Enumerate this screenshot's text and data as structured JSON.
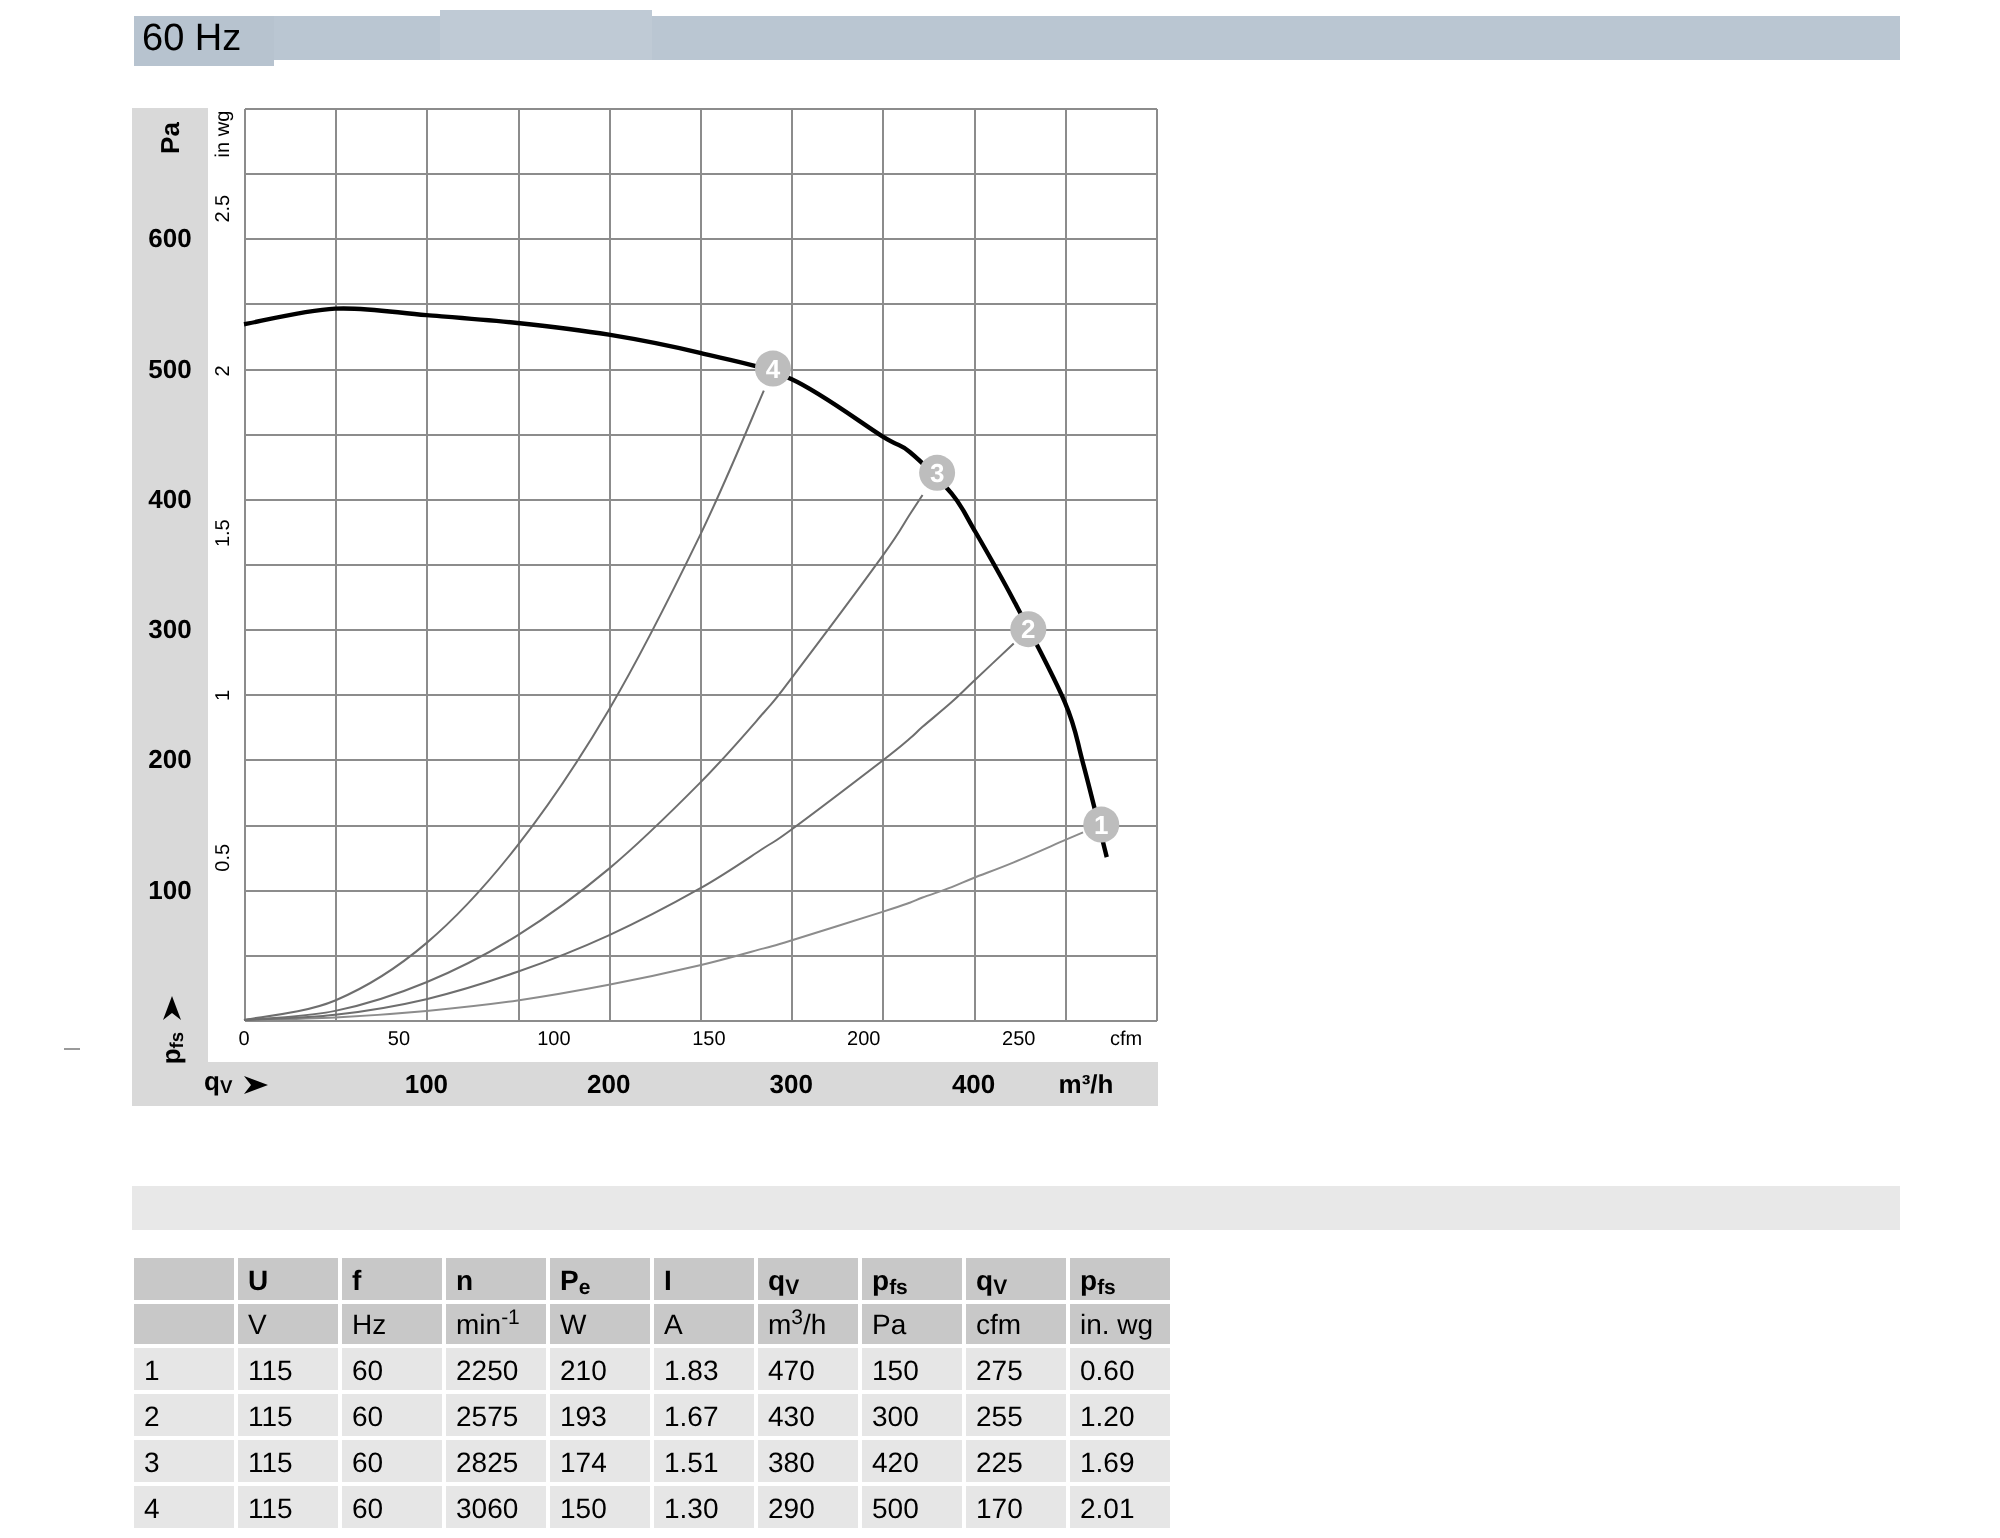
{
  "header": {
    "title": "60 Hz"
  },
  "chart": {
    "y_symbol": {
      "text": "p",
      "sub": "fs"
    },
    "x_symbol": {
      "text": "q",
      "sub": "V"
    },
    "secondary_y_axis": {
      "label": "in wg",
      "ticks": [
        "0.5",
        "1",
        "1.5",
        "2",
        "2.5"
      ]
    },
    "secondary_x_axis": {
      "label": "cfm",
      "ticks": [
        "0",
        "50",
        "100",
        "150",
        "200",
        "250"
      ]
    },
    "chart_data": {
      "type": "line",
      "xlabel": "m³/h",
      "ylabel": "Pa",
      "xlim": [
        0,
        500
      ],
      "ylim": [
        0,
        700
      ],
      "xticks": [
        100,
        200,
        300,
        400
      ],
      "yticks": [
        100,
        200,
        300,
        400,
        500,
        600
      ],
      "grid": true,
      "x": [
        0,
        50,
        100,
        150,
        200,
        250,
        285,
        300,
        350,
        365,
        372,
        388,
        400,
        422,
        450,
        460,
        473
      ],
      "series": [
        {
          "color": "#000000",
          "values": [
            534,
            546,
            541,
            535,
            526,
            512,
            null,
            492,
            448,
            436,
            null,
            404,
            377,
            322,
            244,
            197,
            125
          ]
        },
        {
          "color": "#8c8c8c",
          "values": [
            0,
            2,
            7,
            15,
            27,
            42,
            55,
            61,
            83,
            90,
            94,
            102,
            109,
            121,
            138,
            144,
            null
          ]
        },
        {
          "color": "#6e6e6e",
          "values": [
            0,
            4,
            16,
            37,
            65,
            101,
            132,
            146,
            199,
            216,
            225,
            244,
            260,
            289,
            null,
            null,
            null
          ]
        },
        {
          "color": "#6e6e6e",
          "values": [
            0,
            7,
            29,
            65,
            116,
            182,
            236,
            262,
            356,
            388,
            403,
            null,
            null,
            null,
            null,
            null,
            null
          ]
        },
        {
          "color": "#6e6e6e",
          "values": [
            0,
            15,
            59,
            134,
            238,
            372,
            483,
            null,
            null,
            null,
            null,
            null,
            null,
            null,
            null,
            null,
            null
          ]
        }
      ],
      "annotations": [
        {
          "x": 470,
          "y": 150,
          "text": "1"
        },
        {
          "x": 430,
          "y": 300,
          "text": "2"
        },
        {
          "x": 380,
          "y": 420,
          "text": "3"
        },
        {
          "x": 290,
          "y": 500,
          "text": "4"
        }
      ]
    }
  },
  "table": {
    "header_rows": [
      [
        "U",
        "f",
        "n",
        "P$_{e}$",
        "I",
        "q$_{V}$",
        "p$_{fs}$",
        "q$_{V}$",
        "p$_{fs}$"
      ],
      [
        "V",
        "Hz",
        "min$^{-1}$",
        "W",
        "A",
        "m$^{3}$/h",
        "Pa",
        "cfm",
        "in. wg"
      ]
    ],
    "rows": [
      [
        "1",
        "115",
        "60",
        "2250",
        "210",
        "1.83",
        "470",
        "150",
        "275",
        "0.60"
      ],
      [
        "2",
        "115",
        "60",
        "2575",
        "193",
        "1.67",
        "430",
        "300",
        "255",
        "1.20"
      ],
      [
        "3",
        "115",
        "60",
        "2825",
        "174",
        "1.51",
        "380",
        "420",
        "225",
        "1.69"
      ],
      [
        "4",
        "115",
        "60",
        "3060",
        "150",
        "1.30",
        "290",
        "500",
        "170",
        "2.01"
      ]
    ]
  }
}
